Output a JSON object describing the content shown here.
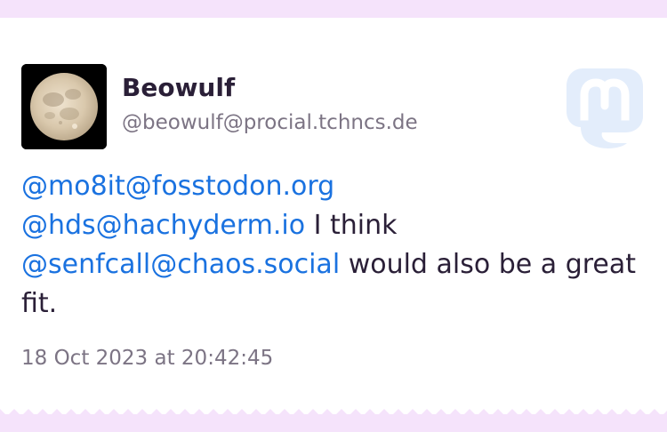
{
  "post": {
    "author": {
      "display_name": "Beowulf",
      "handle": "@beowulf@procial.tchncs.de",
      "avatar_icon": "full-moon-avatar"
    },
    "content": {
      "mention_1": "@mo8it@fosstodon.org",
      "mention_2": "@hds@hachyderm.io",
      "text_1": " I think ",
      "mention_3": "@senfcall@chaos.social",
      "text_2": " would also be a great fit."
    },
    "timestamp": "18 Oct 2023 at 20:42:45",
    "brand_icon": "mastodon-logo-icon"
  },
  "colors": {
    "background": "#f5e3fb",
    "card": "#ffffff",
    "text": "#2a1f37",
    "secondary_text": "#7c7484",
    "link": "#1a72e0",
    "logo": "#e3edfb"
  }
}
